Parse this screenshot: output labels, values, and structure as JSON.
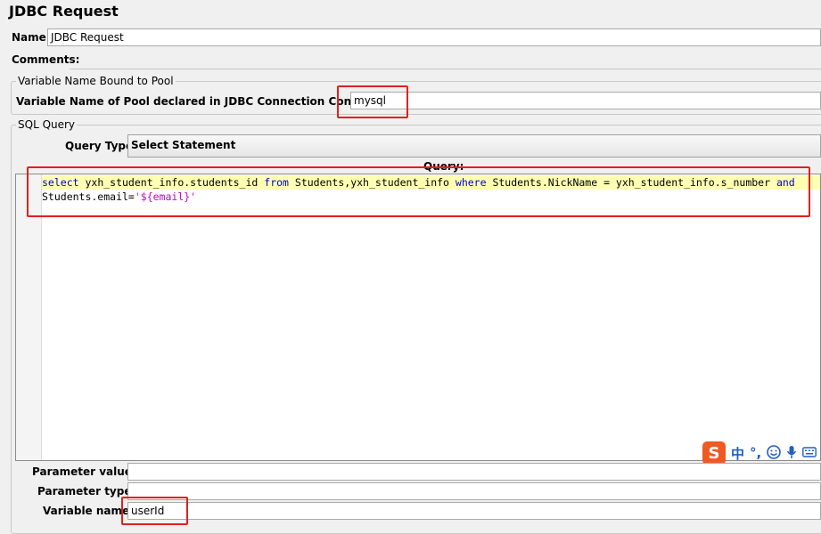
{
  "title": "JDBC Request",
  "name": {
    "label": "Name:",
    "value": "JDBC Request"
  },
  "comments": {
    "label": "Comments:"
  },
  "pool_group": {
    "legend": "Variable Name Bound to Pool",
    "label": "Variable Name of Pool declared in JDBC Connection Configuration:",
    "value": "mysql"
  },
  "sql_group": {
    "legend": "SQL Query",
    "query_type_label": "Query Type:",
    "query_type_value": "Select Statement",
    "query_label": "Query:",
    "line1": {
      "k1": "select",
      "t1": " yxh_student_info.students_id ",
      "k2": "from",
      "t2": " Students,yxh_student_info ",
      "k3": "where",
      "t3": " Students.NickName = yxh_student_info.s_number ",
      "k4": "and"
    },
    "line2": {
      "t1": "Students.email=",
      "s1": "'${email}'"
    }
  },
  "params": {
    "values_label": "Parameter values:",
    "values_value": "",
    "types_label": "Parameter types:",
    "types_value": "",
    "varnames_label": "Variable names:",
    "varnames_value": "userId"
  },
  "ime_bar": {
    "logo": "S",
    "lang": "中",
    "punct": "°,",
    "icons": [
      "smiley-icon",
      "microphone-icon",
      "keyboard-icon"
    ]
  }
}
